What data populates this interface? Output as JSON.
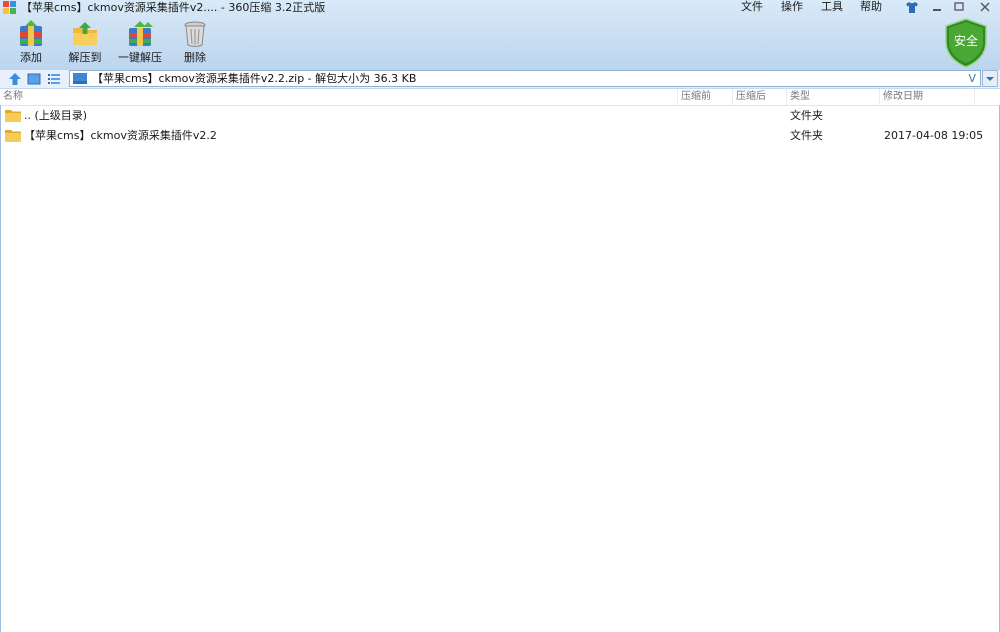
{
  "window": {
    "title": "【苹果cms】ckmov资源采集插件v2.... - 360压缩 3.2正式版"
  },
  "menu": [
    {
      "label": "文件"
    },
    {
      "label": "操作"
    },
    {
      "label": "工具"
    },
    {
      "label": "帮助"
    }
  ],
  "toolbar": {
    "add_label": "添加",
    "extract_to_label": "解压到",
    "one_click_label": "一键解压",
    "delete_label": "删除"
  },
  "security_badge": "安全",
  "address": {
    "path_text": "【苹果cms】ckmov资源采集插件v2.2.zip - 解包大小为 36.3 KB",
    "v_glyph": "V"
  },
  "columns": {
    "name": "名称",
    "compressed": "压缩前",
    "uncompressed": "压缩后",
    "type": "类型",
    "modified": "修改日期"
  },
  "files": [
    {
      "name": ".. (上级目录)",
      "type": "文件夹",
      "date": ""
    },
    {
      "name": "【苹果cms】ckmov资源采集插件v2.2",
      "type": "文件夹",
      "date": "2017-04-08 19:05"
    }
  ],
  "colors": {
    "header_bg": "#c9def2",
    "shield_green": "#3f9a2a",
    "folder_yellow": "#f1c64a"
  }
}
